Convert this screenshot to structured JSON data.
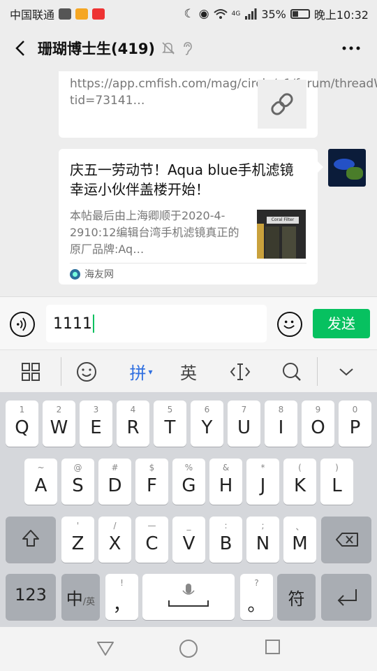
{
  "status_bar": {
    "carrier": "中国联通",
    "network": "4G",
    "battery": "35%",
    "battery_level": 0.35,
    "time": "晚上10:32"
  },
  "header": {
    "title": "珊瑚博士生(419)"
  },
  "messages": {
    "link_card": {
      "url": "https://app.cmfish.com/mag/circle/v1/forum/threadWapPage?tid=73141…"
    },
    "article_card": {
      "title": "庆五一劳动节！Aqua blue手机滤镜幸运小伙伴盖楼开始！",
      "description": "本帖最后由上海卿顺于2020-4-2910:12编辑台湾手机滤镜真正的原厂品牌:Aq…",
      "thumb_label": "Coral Filter",
      "source": "海友网"
    }
  },
  "input_bar": {
    "value": "1111",
    "send_label": "发送"
  },
  "toolbar": {
    "pinyin_label": "拼",
    "english_label": "英"
  },
  "keyboard": {
    "row1": [
      {
        "sub": "1",
        "main": "Q"
      },
      {
        "sub": "2",
        "main": "W"
      },
      {
        "sub": "3",
        "main": "E"
      },
      {
        "sub": "4",
        "main": "R"
      },
      {
        "sub": "5",
        "main": "T"
      },
      {
        "sub": "6",
        "main": "Y"
      },
      {
        "sub": "7",
        "main": "U"
      },
      {
        "sub": "8",
        "main": "I"
      },
      {
        "sub": "9",
        "main": "O"
      },
      {
        "sub": "0",
        "main": "P"
      }
    ],
    "row2": [
      {
        "sub": "~",
        "main": "A"
      },
      {
        "sub": "@",
        "main": "S"
      },
      {
        "sub": "#",
        "main": "D"
      },
      {
        "sub": "$",
        "main": "F"
      },
      {
        "sub": "%",
        "main": "G"
      },
      {
        "sub": "&",
        "main": "H"
      },
      {
        "sub": "*",
        "main": "J"
      },
      {
        "sub": "(",
        "main": "K"
      },
      {
        "sub": ")",
        "main": "L"
      }
    ],
    "row3": [
      {
        "sub": "'",
        "main": "Z"
      },
      {
        "sub": "/",
        "main": "X"
      },
      {
        "sub": "—",
        "main": "C"
      },
      {
        "sub": "_",
        "main": "V"
      },
      {
        "sub": ":",
        "main": "B"
      },
      {
        "sub": ";",
        "main": "N"
      },
      {
        "sub": "、",
        "main": "M"
      }
    ],
    "num_label": "123",
    "lang_main": "中",
    "lang_sub": "/英",
    "comma_sub": "!",
    "comma_main": "，",
    "period_sub": "?",
    "period_main": "。",
    "symbol_label": "符"
  }
}
